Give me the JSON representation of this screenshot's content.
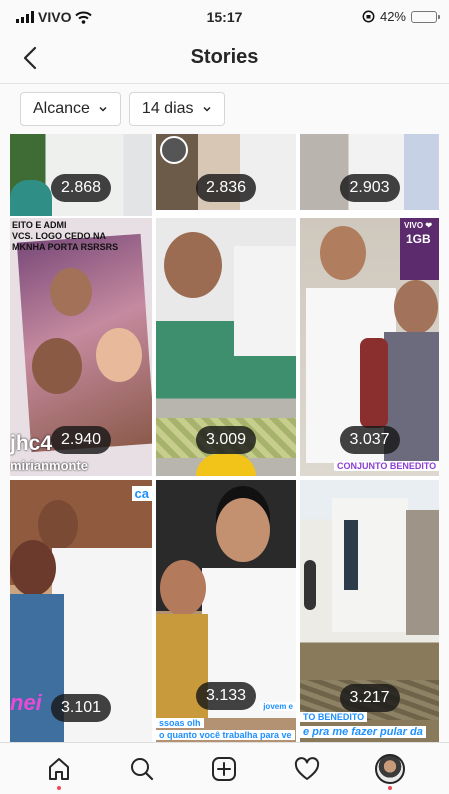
{
  "status_bar": {
    "carrier": "VIVO",
    "time": "15:17",
    "battery": "42%",
    "battery_level": 0.42
  },
  "header": {
    "title": "Stories",
    "back_icon": "chevron-left-icon"
  },
  "filters": [
    {
      "label": "Alcance"
    },
    {
      "label": "14 dias"
    }
  ],
  "stories": [
    {
      "reach": "2.868"
    },
    {
      "reach": "2.836"
    },
    {
      "reach": "2.903"
    },
    {
      "reach": "2.940",
      "captions": [
        "jhc4",
        "mirianmonte",
        "EITO E ADMI",
        "VCS. LOGO CEDO NA",
        "MKNHA PORTA RSRSRS"
      ]
    },
    {
      "reach": "3.009"
    },
    {
      "reach": "3.037",
      "captions": [
        "CONJUNTO BENEDITO B",
        "VIVO ❤",
        "1GB"
      ]
    },
    {
      "reach": "3.101",
      "captions": [
        "ca",
        "nei"
      ]
    },
    {
      "reach": "3.133",
      "captions": [
        "ssoas olh",
        "o quanto você trabalha para ve",
        "jovem e"
      ]
    },
    {
      "reach": "3.217",
      "captions": [
        "TO BENEDITO",
        "e pra me fazer pular da"
      ]
    }
  ],
  "tab_bar": [
    "home-icon",
    "search-icon",
    "new-post-icon",
    "activity-heart-icon",
    "profile-avatar"
  ],
  "colors": {
    "accent": "#1e90ff",
    "badge_bg": "#191919",
    "notification_dot": "#ed4956"
  }
}
